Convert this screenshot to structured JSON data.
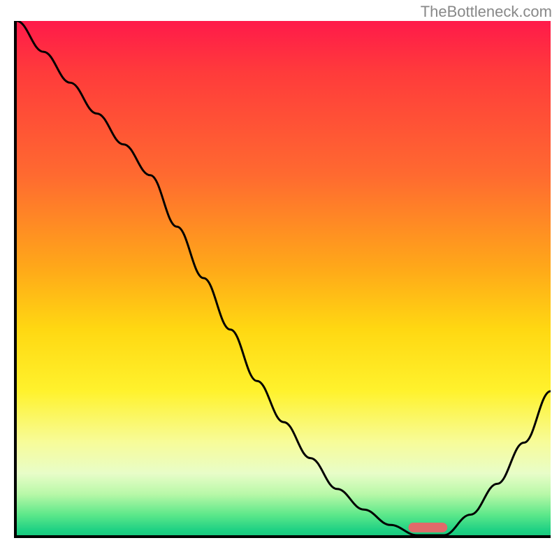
{
  "watermark": "TheBottleneck.com",
  "chart_data": {
    "type": "line",
    "title": "",
    "xlabel": "",
    "ylabel": "",
    "xlim": [
      0,
      100
    ],
    "ylim": [
      0,
      100
    ],
    "series": [
      {
        "name": "bottleneck-curve",
        "x": [
          0,
          5,
          10,
          15,
          20,
          25,
          30,
          35,
          40,
          45,
          50,
          55,
          60,
          65,
          70,
          75,
          80,
          85,
          90,
          95,
          100
        ],
        "values": [
          100,
          94,
          88,
          82,
          76,
          70,
          60,
          50,
          40,
          30,
          22,
          15,
          9,
          5,
          2,
          0,
          0,
          4,
          10,
          18,
          28
        ]
      }
    ],
    "marker": {
      "shape": "rounded-rect",
      "x": 77,
      "y": 1.5,
      "color": "#e06a6a"
    },
    "background_gradient": {
      "stops": [
        {
          "pos": 0,
          "color": "#ff1a4a"
        },
        {
          "pos": 30,
          "color": "#ff6a30"
        },
        {
          "pos": 60,
          "color": "#ffd812"
        },
        {
          "pos": 82,
          "color": "#f7fc9a"
        },
        {
          "pos": 96,
          "color": "#5de88a"
        },
        {
          "pos": 100,
          "color": "#19c97e"
        }
      ]
    }
  }
}
